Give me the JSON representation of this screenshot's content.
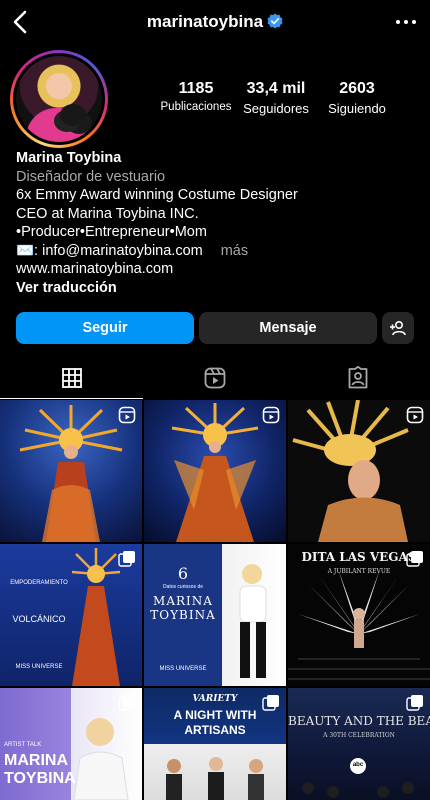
{
  "header": {
    "username": "marinatoybina",
    "back_icon": "chevron-left-icon",
    "verified_icon": "verified-badge-icon",
    "more_icon": "more-horizontal-icon"
  },
  "stats": [
    {
      "value": "1185",
      "label": "Publicaciones"
    },
    {
      "value": "33,4 mil",
      "label": "Seguidores"
    },
    {
      "value": "2603",
      "label": "Siguiendo"
    }
  ],
  "bio": {
    "name": "Marina Toybina",
    "category": "Diseñador de vestuario",
    "line1": "6x Emmy Award winning Costume Designer",
    "line2": "CEO at Marina Toybina INC.",
    "line3": "•Producer•Entrepreneur•Mom",
    "line4": "✉️: info@marinatoybina.com",
    "more": "más",
    "website": "www.marinatoybina.com",
    "translate": "Ver traducción"
  },
  "actions": {
    "follow": "Seguir",
    "message": "Mensaje",
    "add_icon": "add-person-icon"
  },
  "tabs": [
    "grid-icon",
    "reels-icon",
    "tagged-icon"
  ],
  "colors": {
    "accent": "#0095f6",
    "button_dark": "#262626",
    "secondary_text": "#a8a8a8"
  },
  "posts": {
    "p4_title": "EMPODERAMIENTO",
    "p4_sub": "VOLCÁNICO",
    "p4_brand": "MISS UNIVERSE",
    "p5_num": "6",
    "p5_small": "Datos curiosos de",
    "p5_name1": "MARINA",
    "p5_name2": "TOYBINA",
    "p5_brand": "MISS UNIVERSE",
    "p6_title": "DITA LAS VEGAS",
    "p6_sub": "A JUBILANT REVUE",
    "p7_label": "ARTIST TALK",
    "p7_name1": "MARINA",
    "p7_name2": "TOYBINA",
    "p8_brand": "VARIETY",
    "p8_title1": "A NIGHT WITH",
    "p8_title2": "ARTISANS",
    "p9_title": "BEAUTY AND THE BEAST",
    "p9_sub": "A 30TH CELEBRATION",
    "p9_net": "abc"
  }
}
